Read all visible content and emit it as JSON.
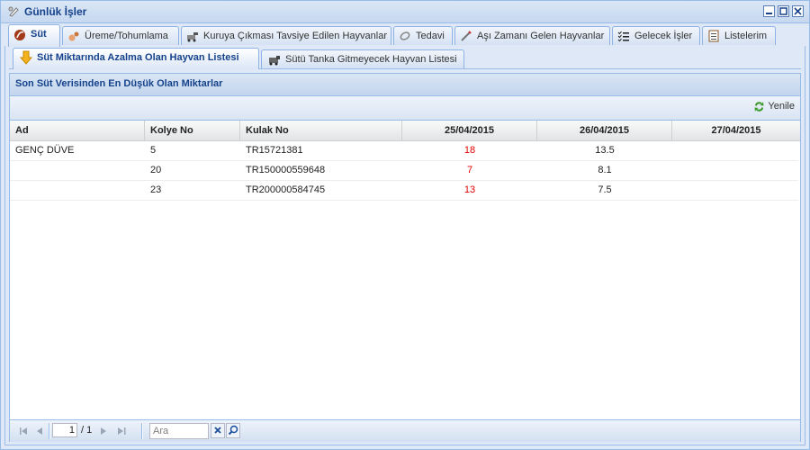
{
  "window": {
    "title": "Günlük İşler",
    "icon": "daily-tasks-icon"
  },
  "tabs": [
    {
      "label": "Süt",
      "icon": "milk-icon",
      "active": true
    },
    {
      "label": "Üreme/Tohumlama",
      "icon": "breeding-icon"
    },
    {
      "label": "Kuruya Çıkması Tavsiye Edilen Hayvanlar",
      "icon": "dry-off-icon"
    },
    {
      "label": "Tedavi",
      "icon": "treatment-icon"
    },
    {
      "label": "Aşı Zamanı Gelen Hayvanlar",
      "icon": "vaccine-icon"
    },
    {
      "label": "Gelecek İşler",
      "icon": "task-list-icon"
    },
    {
      "label": "Listelerim",
      "icon": "list-icon"
    }
  ],
  "subtabs": [
    {
      "label": "Süt Miktarında Azalma Olan Hayvan Listesi",
      "icon": "arrow-down-icon",
      "active": true
    },
    {
      "label": "Sütü Tanka Gitmeyecek Hayvan Listesi",
      "icon": "tank-icon"
    }
  ],
  "panel": {
    "title": "Son Süt Verisinden En Düşük Olan Miktarlar",
    "refresh_label": "Yenile"
  },
  "grid": {
    "columns": [
      "Ad",
      "Kolye No",
      "Kulak No",
      "25/04/2015",
      "26/04/2015",
      "27/04/2015"
    ],
    "rows": [
      {
        "ad": "GENÇ DÜVE",
        "kolye": "5",
        "kulak": "TR15721381",
        "d1": "18",
        "d2": "13.5",
        "d3": ""
      },
      {
        "ad": "",
        "kolye": "20",
        "kulak": "TR150000559648",
        "d1": "7",
        "d2": "8.1",
        "d3": ""
      },
      {
        "ad": "",
        "kolye": "23",
        "kulak": "TR200000584745",
        "d1": "13",
        "d2": "7.5",
        "d3": ""
      }
    ],
    "highlight_color": "#e00000"
  },
  "pager": {
    "page": "1",
    "total": "/ 1",
    "search_placeholder": "Ara"
  }
}
